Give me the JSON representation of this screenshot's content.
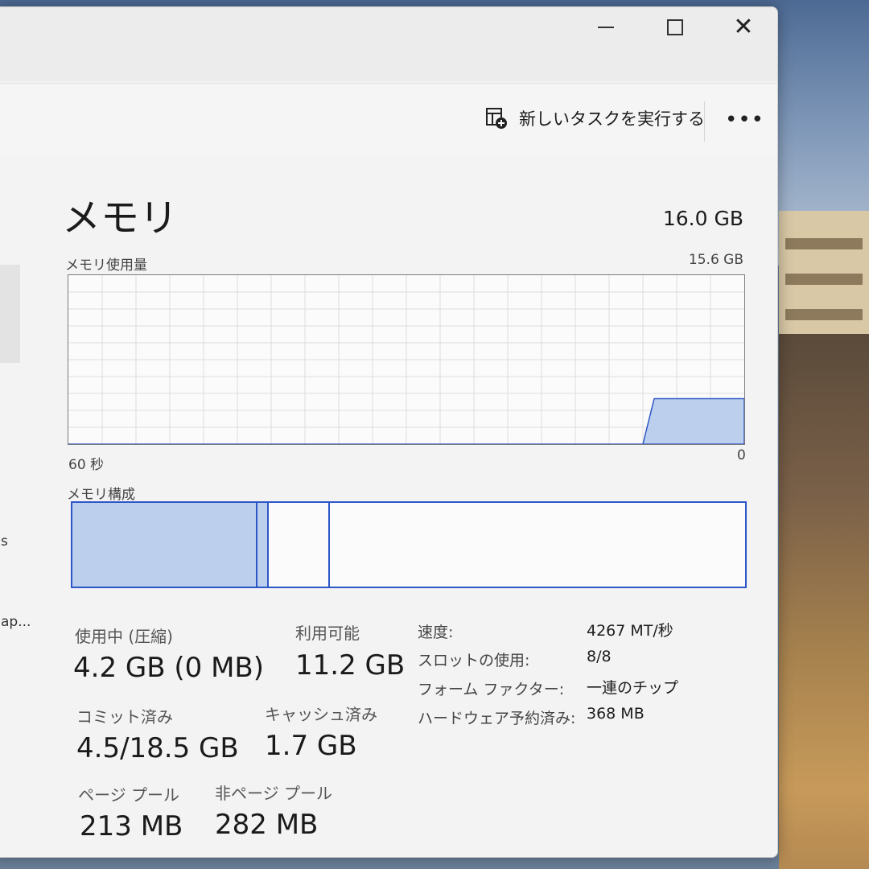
{
  "window": {
    "minimize_icon": "minimize-icon",
    "maximize_icon": "maximize-icon",
    "close_icon": "close-icon",
    "close_glyph": "✕"
  },
  "toolbar": {
    "run_new_task": "新しいタスクを実行する",
    "run_icon": "new-task-icon",
    "more": "•••"
  },
  "sidebar": {
    "fragment_1": "s",
    "fragment_2": "ap..."
  },
  "memory": {
    "title": "メモリ",
    "total": "16.0 GB",
    "usage_label": "メモリ使用量",
    "usage_max": "15.6 GB",
    "time_left": "60 秒",
    "time_right": "0",
    "composition_label": "メモリ構成"
  },
  "chart_data": {
    "type": "area",
    "title": "メモリ使用量",
    "x_label_left": "60 秒",
    "x_label_right": "0",
    "ylim": [
      0,
      15.6
    ],
    "series": [
      {
        "values": [
          0,
          0,
          0,
          0,
          0,
          0,
          0,
          0,
          0,
          0,
          0,
          0,
          0,
          0,
          0,
          0,
          0,
          0,
          0,
          0,
          0,
          0,
          0,
          0,
          0,
          0,
          0,
          0,
          0,
          0,
          0,
          0,
          0,
          0,
          0,
          0,
          0,
          0,
          0,
          0,
          0,
          0,
          0,
          0,
          0,
          0,
          0,
          0,
          0,
          0,
          0,
          0,
          4.2,
          4.2,
          4.2,
          4.2,
          4.2,
          4.2,
          4.2,
          4.2,
          4.2
        ]
      }
    ],
    "grid": true
  },
  "stats": {
    "in_use_label": "使用中 (圧縮)",
    "in_use_value": "4.2 GB (0 MB)",
    "available_label": "利用可能",
    "available_value": "11.2 GB",
    "committed_label": "コミット済み",
    "committed_value": "4.5/18.5 GB",
    "cached_label": "キャッシュ済み",
    "cached_value": "1.7 GB",
    "paged_label": "ページ プール",
    "paged_value": "213 MB",
    "nonpaged_label": "非ページ プール",
    "nonpaged_value": "282 MB"
  },
  "details": [
    {
      "label": "速度:",
      "value": "4267 MT/秒"
    },
    {
      "label": "スロットの使用:",
      "value": "8/8"
    },
    {
      "label": "フォーム ファクター:",
      "value": "一連のチップ"
    },
    {
      "label": "ハードウェア予約済み:",
      "value": "368 MB"
    }
  ],
  "colors": {
    "accent": "#2d56c7",
    "fill": "#bcd0ee",
    "grid": "#dcdcdc"
  }
}
